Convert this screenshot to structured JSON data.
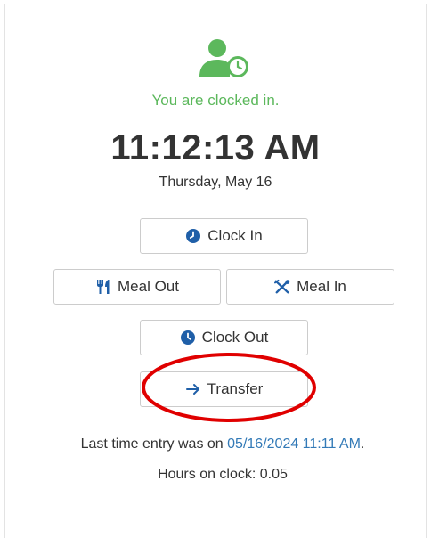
{
  "status": {
    "icon": "user-clock-icon",
    "text": "You are clocked in.",
    "color": "#5cb85c"
  },
  "clock": {
    "time": "11:12:13 AM",
    "date": "Thursday, May 16"
  },
  "buttons": {
    "clock_in": {
      "label": "Clock In",
      "icon": "clock-icon"
    },
    "meal_out": {
      "label": "Meal Out",
      "icon": "utensils-icon"
    },
    "meal_in": {
      "label": "Meal In",
      "icon": "utensils-crossed-icon"
    },
    "clock_out": {
      "label": "Clock Out",
      "icon": "clock-icon"
    },
    "transfer": {
      "label": "Transfer",
      "icon": "arrow-right-icon"
    }
  },
  "annotation": {
    "highlight_color": "#e00000"
  },
  "info": {
    "last_entry_prefix": "Last time entry was on",
    "last_entry_value": "05/16/2024 11:11 AM",
    "last_entry_suffix": ".",
    "hours_label": "Hours on clock:",
    "hours_value": "0.05"
  },
  "colors": {
    "icon_blue": "#1f5fa8",
    "link_blue": "#337ab7",
    "success_green": "#5cb85c"
  }
}
